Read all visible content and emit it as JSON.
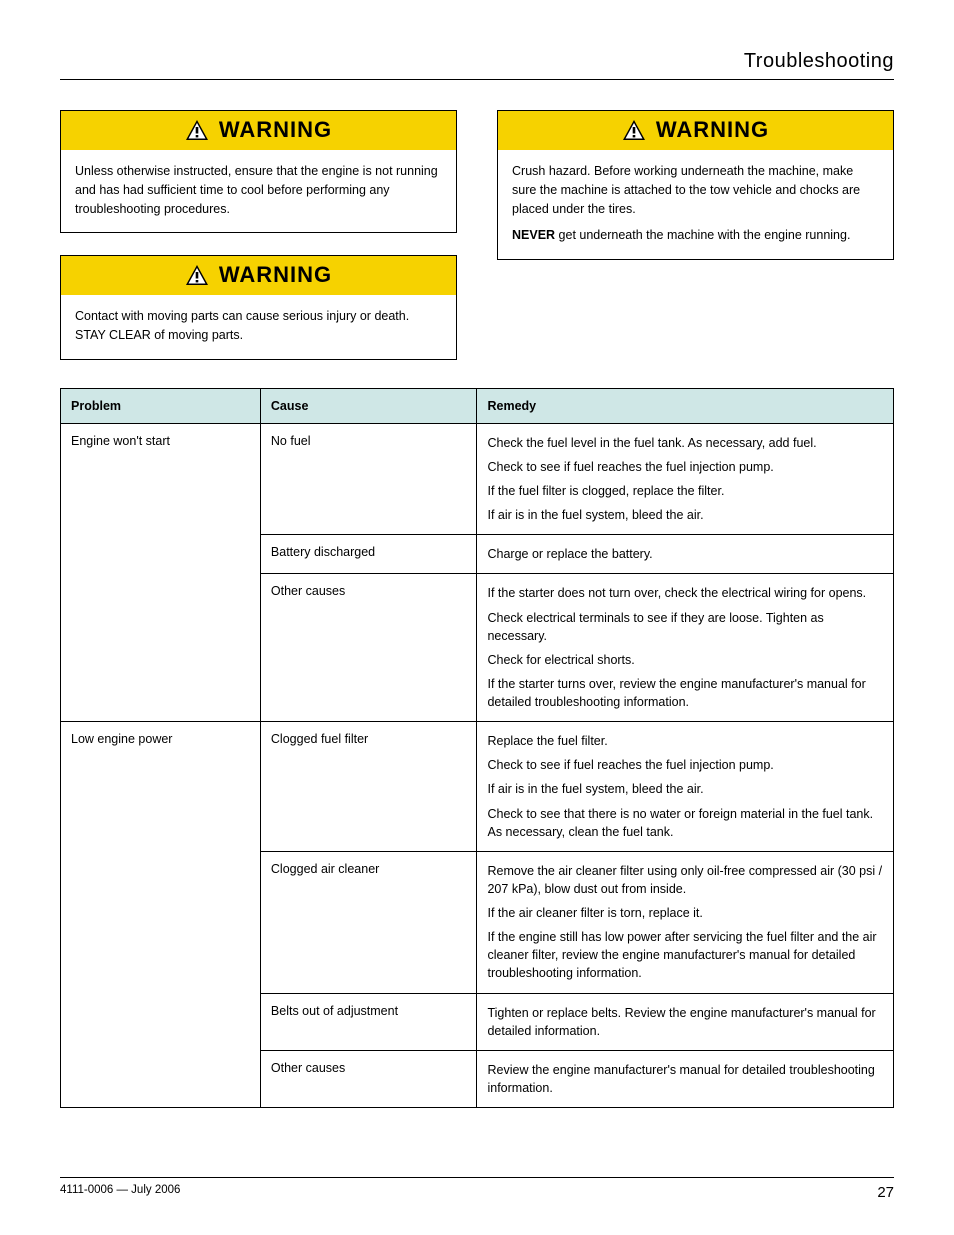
{
  "chapter_title": "Troubleshooting",
  "warn_label": "WARNING",
  "warnings": {
    "w1": "Unless otherwise instructed, ensure that the engine is not running and has had sufficient time to cool before performing any troubleshooting procedures.",
    "w2": "Contact with moving parts can cause serious injury or death. STAY CLEAR of moving parts.",
    "w3_1": "Crush hazard. Before working underneath the machine, make sure the machine is attached to the tow vehicle and chocks are placed under the tires.",
    "w3_2_bold": "NEVER",
    "w3_2_rest": " get underneath the machine with the engine running."
  },
  "table": {
    "headers": {
      "problem": "Problem",
      "cause": "Cause",
      "remedy": "Remedy"
    },
    "groups": [
      {
        "problem": "Engine won't start",
        "rows": [
          {
            "cause": "No fuel",
            "remedy": [
              "Check the fuel level in the fuel tank. As necessary, add fuel.",
              "Check to see if fuel reaches the fuel injection pump.",
              "If the fuel filter is clogged, replace the filter.",
              "If air is in the fuel system, bleed the air."
            ]
          },
          {
            "cause": "Battery discharged",
            "remedy": [
              "Charge or replace the battery."
            ]
          },
          {
            "cause": "Other causes",
            "remedy": [
              "If the starter does not turn over, check the electrical wiring for opens.",
              "Check electrical terminals to see if they are loose. Tighten as necessary.",
              "Check for electrical shorts.",
              "If the starter turns over, review the engine manufacturer's manual for detailed troubleshooting information."
            ]
          }
        ]
      },
      {
        "problem": "Low engine power",
        "rows": [
          {
            "cause": "Clogged fuel filter",
            "remedy": [
              "Replace the fuel filter.",
              "Check to see if fuel reaches the fuel injection pump.",
              "If air is in the fuel system, bleed the air.",
              "Check to see that there is no water or foreign material in the fuel tank. As necessary, clean the fuel tank."
            ]
          },
          {
            "cause": "Clogged air cleaner",
            "remedy": [
              "Remove the air cleaner filter using only oil-free compressed air (30 psi / 207 kPa), blow dust out from inside.",
              "If the air cleaner filter is torn, replace it.",
              "If the engine still has low power after servicing the fuel filter and the air cleaner filter, review the engine manufacturer's manual for detailed troubleshooting information."
            ]
          },
          {
            "cause": "Belts out of adjustment",
            "remedy": [
              "Tighten or replace belts. Review the engine manufacturer's manual for detailed information."
            ]
          },
          {
            "cause": "Other causes",
            "remedy": [
              "Review the engine manufacturer's manual for detailed troubleshooting information."
            ]
          }
        ]
      }
    ]
  },
  "footer": {
    "left": "4111-0006 — July 2006",
    "right": "27"
  }
}
